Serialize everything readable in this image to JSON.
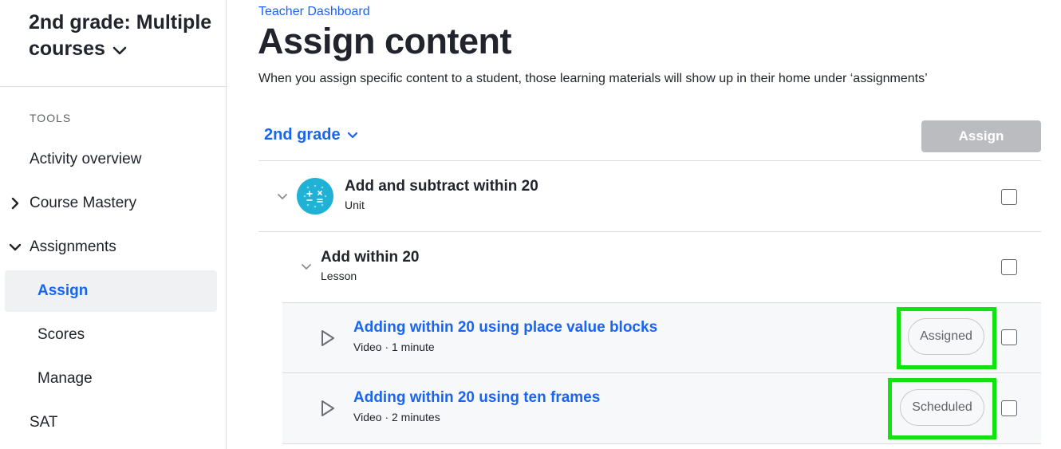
{
  "sidebar": {
    "course_title": "2nd grade: Multiple courses",
    "tools_label": "TOOLS",
    "items": [
      {
        "label": "Activity overview"
      },
      {
        "label": "Course Mastery"
      },
      {
        "label": "Assignments"
      },
      {
        "label": "Assign"
      },
      {
        "label": "Scores"
      },
      {
        "label": "Manage"
      },
      {
        "label": "SAT"
      }
    ]
  },
  "header": {
    "breadcrumb": "Teacher Dashboard",
    "title": "Assign content",
    "description": "When you assign specific content to a student, those learning materials will show up in their home under ‘assignments’"
  },
  "toolbar": {
    "grade_select": "2nd grade",
    "assign_label": "Assign"
  },
  "content": {
    "unit": {
      "title": "Add and subtract within 20",
      "type": "Unit"
    },
    "lesson": {
      "title": "Add within 20",
      "type": "Lesson"
    },
    "videos": [
      {
        "title": "Adding within 20 using place value blocks",
        "meta": "Video · 1 minute",
        "status": "Assigned"
      },
      {
        "title": "Adding within 20 using ten frames",
        "meta": "Video · 2 minutes",
        "status": "Scheduled"
      }
    ]
  },
  "colors": {
    "accent": "#1865f2",
    "highlight": "#11e311",
    "unit_icon": "#1fb2d4"
  }
}
